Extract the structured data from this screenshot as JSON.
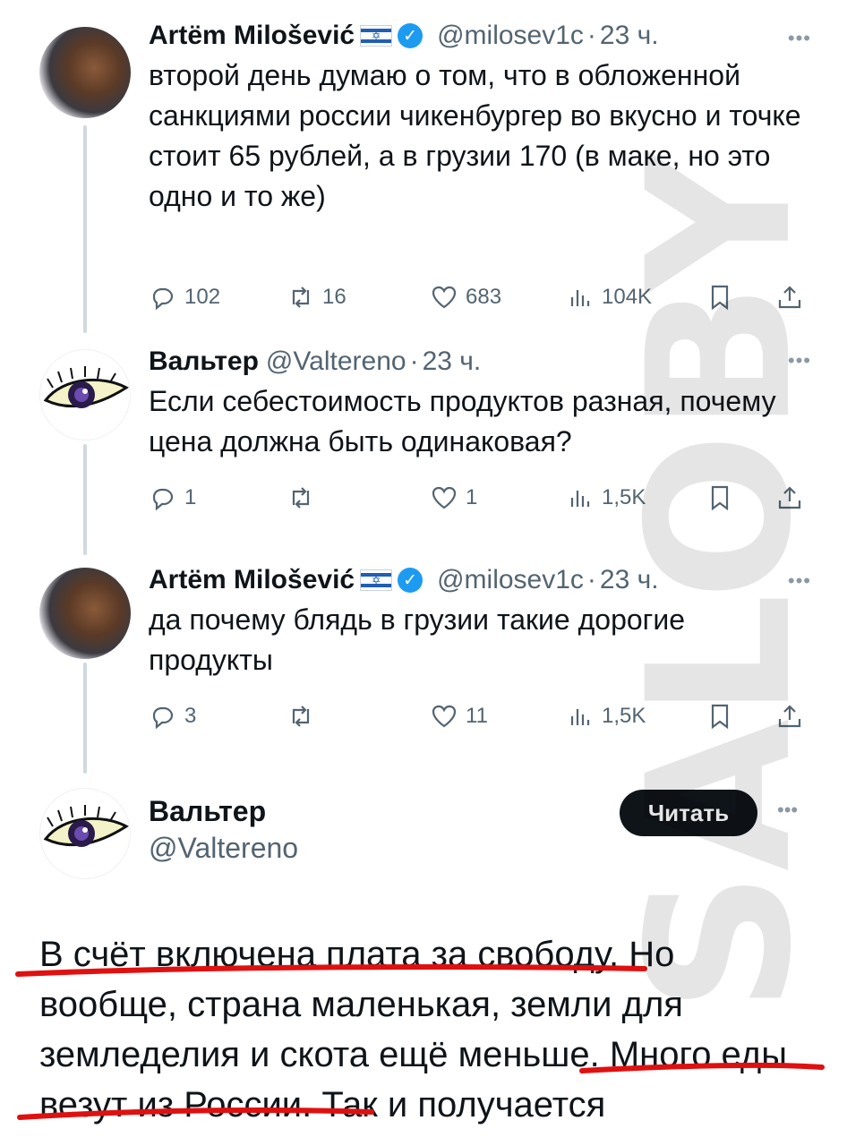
{
  "tweets": [
    {
      "name": "Artëm Milošević",
      "handle": "@milosev1c",
      "time": "23 ч.",
      "verified": true,
      "flag": "israel-flag",
      "text": "второй день думаю о том, что в обложенной санкциями россии чикенбургер во вкусно и точке стоит 65 рублей, а в грузии 170 (в маке, но это одно и то же)",
      "replies": "102",
      "reposts": "16",
      "likes": "683",
      "views": "104K"
    },
    {
      "name": "Вальтер",
      "handle": "@Valtereno",
      "time": "23 ч.",
      "verified": false,
      "text": "Если себестоимость продуктов разная, почему цена должна быть одинаковая?",
      "replies": "1",
      "reposts": "",
      "likes": "1",
      "views": "1,5K"
    },
    {
      "name": "Artëm Milošević",
      "handle": "@milosev1c",
      "time": "23 ч.",
      "verified": true,
      "flag": "israel-flag",
      "text": "да почему блядь в грузии такие дорогие продукты",
      "replies": "3",
      "reposts": "",
      "likes": "11",
      "views": "1,5K"
    }
  ],
  "main_tweet": {
    "name": "Вальтер",
    "handle": "@Valtereno",
    "follow_label": "Читать",
    "text_part1": "В счёт включена плата за свободу.",
    "text_part2": " Но вообще, страна маленькая, земли для земледелия и скота ещё меньше. ",
    "text_part3": "Много еды везут из России.",
    "text_part4": " Так и получается"
  },
  "more_label": "•••",
  "dot_separator": "·",
  "watermark_text": "SALOBY",
  "colors": {
    "accent": "#1d9bf0",
    "secondary_text": "#536471",
    "underline_red": "#e01010",
    "watermark": "#000000"
  }
}
